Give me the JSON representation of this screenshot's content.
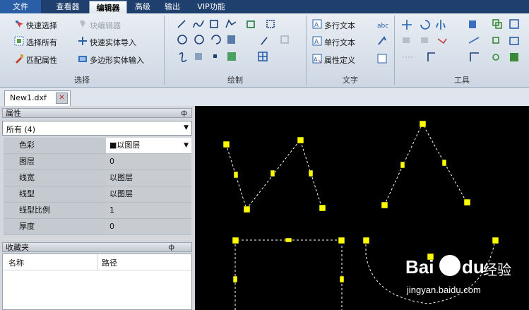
{
  "menu": {
    "file": "文件",
    "viewer": "查看器",
    "editor": "编辑器",
    "advanced": "高级",
    "output": "输出",
    "vip": "VIP功能"
  },
  "ribbon": {
    "select": {
      "quick_select": "快速选择",
      "select_all": "选择所有",
      "match_props": "匹配属性",
      "block_editor": "块编辑器",
      "quick_import": "快速实体导入",
      "polygon_input": "多边形实体输入",
      "label": "选择"
    },
    "draw": {
      "label": "绘制"
    },
    "text": {
      "mtext": "多行文本",
      "stext": "单行文本",
      "attdef": "属性定义",
      "label": "文字"
    },
    "tools": {
      "label": "工具"
    }
  },
  "document_tab": {
    "name": "New1.dxf"
  },
  "properties": {
    "title": "属性",
    "pin": "ф",
    "selector": "所有 (4)",
    "rows": [
      {
        "name": "色彩",
        "value": "■以图层"
      },
      {
        "name": "图层",
        "value": "0"
      },
      {
        "name": "线宽",
        "value": "以图层"
      },
      {
        "name": "线型",
        "value": "以图层"
      },
      {
        "name": "线型比例",
        "value": "1"
      },
      {
        "name": "厚度",
        "value": "0"
      }
    ]
  },
  "favorites": {
    "title": "收藏夹",
    "pin": "ф",
    "col_name": "名称",
    "col_path": "路径"
  },
  "watermark": {
    "brand": "Bai",
    "brand2": "du",
    "cn": "经验",
    "url": "jingyan.baidu.com"
  },
  "colors": {
    "menubar": "#1f3f6e",
    "grip": "#ffff00",
    "dash": "#ffffff",
    "canvas": "#000000"
  }
}
